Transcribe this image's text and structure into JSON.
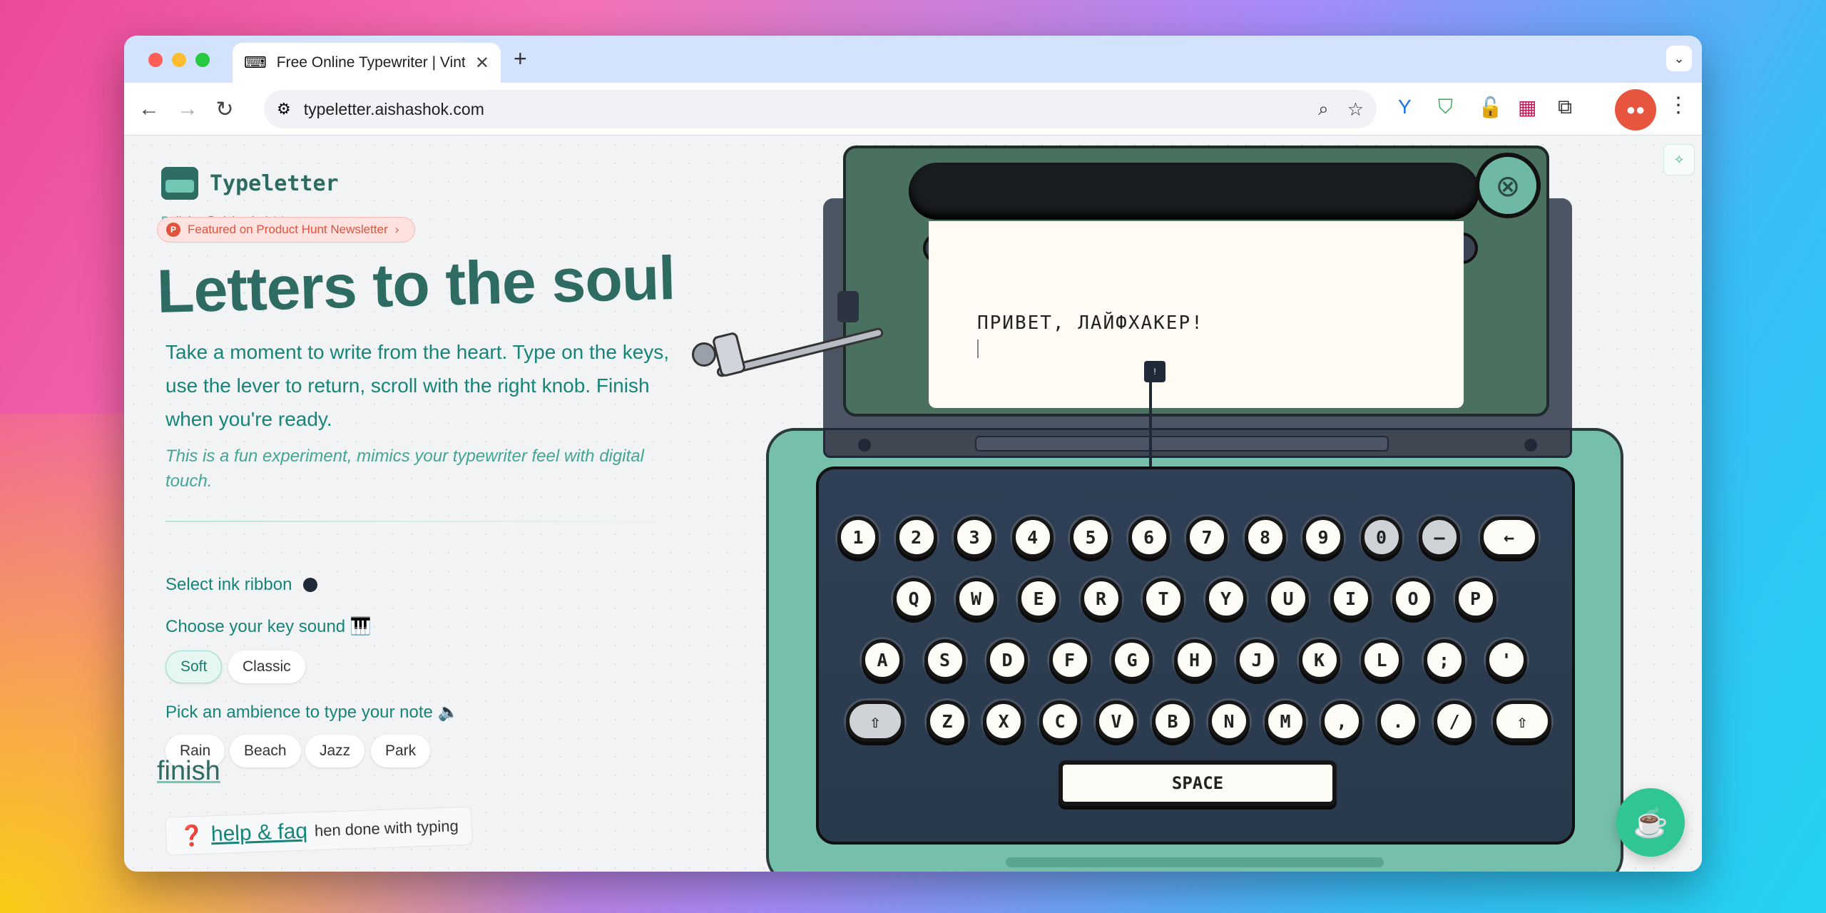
{
  "browser": {
    "tab_title": "Free Online Typewriter | Vintage",
    "url": "typeletter.aishashok.com",
    "colors": {
      "close": "#ff5f57",
      "minimize": "#febc2e",
      "maximize": "#28c840",
      "profile": "#e8553e"
    }
  },
  "brand": {
    "name": "Typeletter",
    "built_by": "Built by @aishashok14",
    "badge": "Featured on Product Hunt Newsletter",
    "badge_icon": "P",
    "badge_chevron": "›"
  },
  "hero": {
    "title": "Letters to the soul",
    "description": "Take a moment to write from the heart. Type on the keys, use the lever to return, scroll with the right knob. Finish when you're ready.",
    "note": "This is a fun experiment, mimics your typewriter feel with digital touch."
  },
  "controls": {
    "ink_label": "Select ink ribbon",
    "ink_color": "#1f2937",
    "sound_label": "Choose your key sound 🎹",
    "sound_options": [
      "Soft",
      "Classic"
    ],
    "sound_selected": "Soft",
    "ambience_label": "Pick an ambience to type your note 🔈",
    "ambience_options": [
      "Rain",
      "Beach",
      "Jazz",
      "Park"
    ]
  },
  "footer": {
    "finish": "finish",
    "help": "help & faq",
    "help_icon": "❓",
    "hint": "hen done with typing"
  },
  "typewriter": {
    "paper_text": "ПРИВЕТ, ЛАЙФХАКЕР!",
    "typebar_char": "!",
    "row1": [
      "1",
      "2",
      "3",
      "4",
      "5",
      "6",
      "7",
      "8",
      "9",
      "0",
      "–",
      "←"
    ],
    "row2": [
      "Q",
      "W",
      "E",
      "R",
      "T",
      "Y",
      "U",
      "I",
      "O",
      "P"
    ],
    "row3": [
      "A",
      "S",
      "D",
      "F",
      "G",
      "H",
      "J",
      "K",
      "L",
      ";",
      "'"
    ],
    "row4": [
      "⇧",
      "Z",
      "X",
      "C",
      "V",
      "B",
      "N",
      "M",
      ",",
      ".",
      "/",
      "⇧"
    ],
    "space": "SPACE",
    "body_color": "#76c0ab",
    "keybed_color": "#2f3f55"
  }
}
